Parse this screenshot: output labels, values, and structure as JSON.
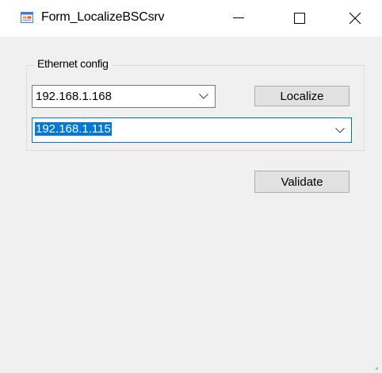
{
  "window": {
    "title": "Form_LocalizeBSCsrv",
    "controls": {
      "minimize": "—",
      "maximize": "☐",
      "close": "✕"
    }
  },
  "ethernet_config": {
    "group_label": "Ethernet config",
    "ip_combo": {
      "value": "192.168.1.168",
      "icon": "chevron-down-icon"
    },
    "target_combo": {
      "value": "192.168.1.115",
      "selected": true,
      "focused": true,
      "icon": "chevron-down-icon"
    },
    "localize_button": "Localize"
  },
  "validate_button": "Validate",
  "colors": {
    "window_background": "#f0f0f0",
    "titlebar_background": "#ffffff",
    "selection": "#0078d7",
    "button_face": "#e1e1e1",
    "button_border": "#adadad"
  }
}
